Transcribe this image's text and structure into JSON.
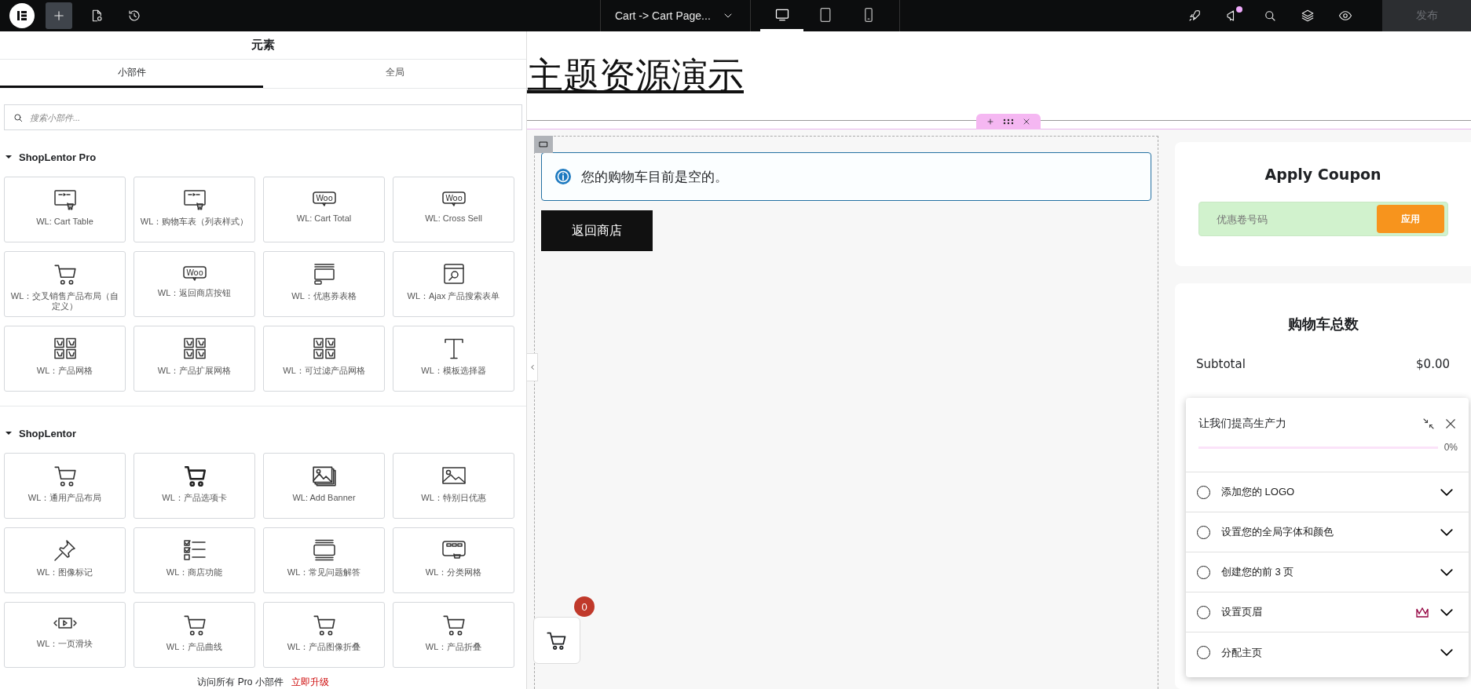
{
  "topbar": {
    "template": "Cart -> Cart Page...",
    "devices": [
      {
        "kind": "desktop",
        "selected": true
      },
      {
        "kind": "tablet",
        "selected": false
      },
      {
        "kind": "mobile",
        "selected": false
      }
    ],
    "notification_dot": true,
    "publish": {
      "label": "发布",
      "disabled": true
    }
  },
  "panel": {
    "title": "元素",
    "tabs": [
      {
        "label": "小部件",
        "selected": true
      },
      {
        "label": "全局",
        "selected": false
      }
    ],
    "search": {
      "placeholder": "搜索小部件..."
    },
    "sections": [
      {
        "title": "ShopLentor Pro",
        "expanded": true,
        "widgets": [
          {
            "label": "WL: Cart Table",
            "kind": "window-cart"
          },
          {
            "label": "WL：购物车表（列表样式）",
            "kind": "window-cart"
          },
          {
            "label": "WL: Cart Total",
            "kind": "woo",
            "icon_text": "Woo"
          },
          {
            "label": "WL: Cross Sell",
            "kind": "woo",
            "icon_text": "Woo"
          },
          {
            "label": "WL：交叉销售产品布局（自定义）",
            "kind": "cart"
          },
          {
            "label": "WL：返回商店按钮",
            "kind": "woo",
            "icon_text": "Woo"
          },
          {
            "label": "WL：优惠券表格",
            "kind": "form"
          },
          {
            "label": "WL：Ajax 产品搜索表单",
            "kind": "search-window"
          },
          {
            "label": "WL：产品网格",
            "kind": "grid"
          },
          {
            "label": "WL：产品扩展网格",
            "kind": "grid"
          },
          {
            "label": "WL：可过滤产品网格",
            "kind": "grid"
          },
          {
            "label": "WL：模板选择器",
            "kind": "text"
          }
        ]
      },
      {
        "title": "ShopLentor",
        "expanded": true,
        "widgets": [
          {
            "label": "WL：通用产品布局",
            "kind": "cart"
          },
          {
            "label": "WL：产品选项卡",
            "kind": "cart-bold"
          },
          {
            "label": "WL: Add Banner",
            "kind": "images"
          },
          {
            "label": "WL：特别日优惠",
            "kind": "image"
          },
          {
            "label": "WL：图像标记",
            "kind": "pin"
          },
          {
            "label": "WL：商店功能",
            "kind": "checklist"
          },
          {
            "label": "WL：常见问题解答",
            "kind": "faq"
          },
          {
            "label": "WL：分类网格",
            "kind": "category"
          },
          {
            "label": "WL：一页滑块",
            "kind": "slider"
          },
          {
            "label": "WL：产品曲线",
            "kind": "cart"
          },
          {
            "label": "WL：产品图像折叠",
            "kind": "cart"
          },
          {
            "label": "WL：产品折叠",
            "kind": "cart"
          }
        ]
      }
    ],
    "footer": {
      "text": "访问所有 Pro 小部件",
      "link": "立即升级"
    }
  },
  "canvas": {
    "site_title": "主题资源演示",
    "notice": "您的购物车目前是空的。",
    "return_button": "返回商店",
    "cart_count": "0",
    "coupon": {
      "title": "Apply Coupon",
      "placeholder": "优惠卷号码",
      "button": "应用"
    },
    "totals": {
      "title": "购物车总数",
      "rows": [
        {
          "label": "Subtotal",
          "value": "$0.00"
        }
      ]
    }
  },
  "checklist": {
    "title": "让我们提高生产力",
    "level": 0,
    "reading": "0%",
    "items": [
      {
        "label": "添加您的 LOGO",
        "checked": false,
        "pro": false
      },
      {
        "label": "设置您的全局字体和颜色",
        "checked": false,
        "pro": false
      },
      {
        "label": "创建您的前 3 页",
        "checked": false,
        "pro": false
      },
      {
        "label": "设置页眉",
        "checked": false,
        "pro": true
      },
      {
        "label": "分配主页",
        "checked": false,
        "pro": false
      }
    ]
  }
}
